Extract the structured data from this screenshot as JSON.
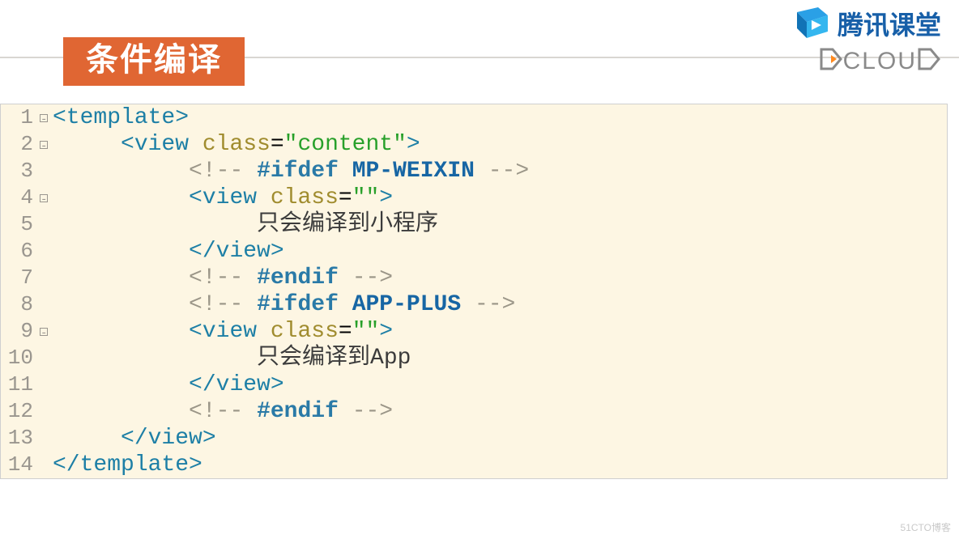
{
  "header": {
    "title": "条件编译",
    "tencent_label": "腾讯课堂",
    "dcloud_label": "CLOU"
  },
  "code": {
    "lines": [
      {
        "n": 1,
        "fold": true,
        "indent": 0,
        "html": "<span class='tag'>&lt;template&gt;</span>"
      },
      {
        "n": 2,
        "fold": true,
        "indent": 1,
        "html": "<span class='tag'>&lt;view</span> <span class='attr'>class</span>=<span class='str'>\"content\"</span><span class='tag'>&gt;</span>"
      },
      {
        "n": 3,
        "fold": false,
        "indent": 2,
        "html": "<span class='cmt'>&lt;!--</span> <span class='kw'>#ifdef</span> <span class='kw2'>MP-WEIXIN</span> <span class='cmt'>--&gt;</span>"
      },
      {
        "n": 4,
        "fold": true,
        "indent": 2,
        "html": "<span class='tag'>&lt;view</span> <span class='attr'>class</span>=<span class='str'>\"\"</span><span class='tag'>&gt;</span>"
      },
      {
        "n": 5,
        "fold": false,
        "indent": 3,
        "html": "<span class='plain'>只会编译到小程序</span>"
      },
      {
        "n": 6,
        "fold": false,
        "indent": 2,
        "html": "<span class='tag'>&lt;/view&gt;</span>"
      },
      {
        "n": 7,
        "fold": false,
        "indent": 2,
        "html": "<span class='cmt'>&lt;!--</span> <span class='kw'>#endif</span> <span class='cmt'>--&gt;</span>"
      },
      {
        "n": 8,
        "fold": false,
        "indent": 2,
        "html": "<span class='cmt'>&lt;!--</span> <span class='kw'>#ifdef</span> <span class='kw2'>APP-PLUS</span> <span class='cmt'>--&gt;</span>"
      },
      {
        "n": 9,
        "fold": true,
        "indent": 2,
        "html": "<span class='tag'>&lt;view</span> <span class='attr'>class</span>=<span class='str'>\"\"</span><span class='tag'>&gt;</span>"
      },
      {
        "n": 10,
        "fold": false,
        "indent": 3,
        "html": "<span class='plain'>只会编译到App</span>"
      },
      {
        "n": 11,
        "fold": false,
        "indent": 2,
        "html": "<span class='tag'>&lt;/view&gt;</span>"
      },
      {
        "n": 12,
        "fold": false,
        "indent": 2,
        "html": "<span class='cmt'>&lt;!--</span> <span class='kw'>#endif</span> <span class='cmt'>--&gt;</span>"
      },
      {
        "n": 13,
        "fold": false,
        "indent": 1,
        "html": "<span class='tag'>&lt;/view&gt;</span>"
      },
      {
        "n": 14,
        "fold": false,
        "indent": 0,
        "html": "<span class='tag'>&lt;/template&gt;</span>"
      }
    ]
  },
  "watermark": "51CTO博客"
}
